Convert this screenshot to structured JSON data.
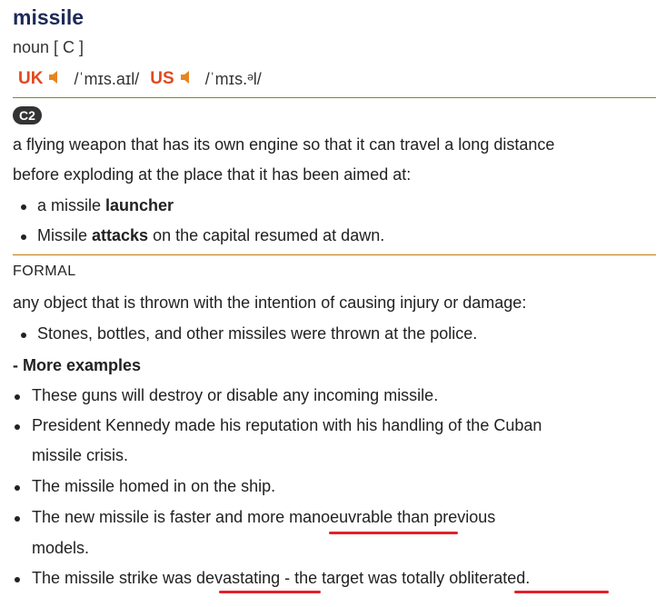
{
  "entry": {
    "headword": "missile",
    "pos": "noun [ C ]",
    "pronunciations": [
      {
        "region": "UK",
        "ipa": "/ˈmɪs.aɪl/"
      },
      {
        "region": "US",
        "ipa": "/ˈmɪs.ᵊl/"
      }
    ],
    "sense1": {
      "level": "C2",
      "definition_line1": "a flying weapon that has its own engine so that it can travel a long distance",
      "definition_line2": "before exploding at the place that it has been aimed at:",
      "examples": [
        {
          "pre": "a missile ",
          "bold": "launcher",
          "post": ""
        },
        {
          "pre": "Missile ",
          "bold": "attacks",
          "post": " on the capital resumed at dawn."
        }
      ]
    },
    "sense2": {
      "label": "FORMAL",
      "definition": "any object that is thrown with the intention of causing injury or damage:",
      "examples": [
        "Stones, bottles, and other missiles were thrown at the police."
      ]
    },
    "more_examples": {
      "heading": "- More examples",
      "items": [
        {
          "line1": "These guns will destroy or disable any incoming missile."
        },
        {
          "line1": "President Kennedy made his reputation with his handling of the Cuban",
          "line2": "missile crisis."
        },
        {
          "line1": "The missile homed in on the ship."
        },
        {
          "pre": "The new missile is faster and more ",
          "u": "manoeuvrable",
          "post": " than previous",
          "line2": "models."
        },
        {
          "pre": "The missile strike was ",
          "u1": "devastating",
          "mid": " - the target was totally ",
          "u2": "obliterated",
          "post": "."
        }
      ]
    },
    "colors": {
      "region": "#e04a1f",
      "underline": "#e2202a"
    }
  }
}
